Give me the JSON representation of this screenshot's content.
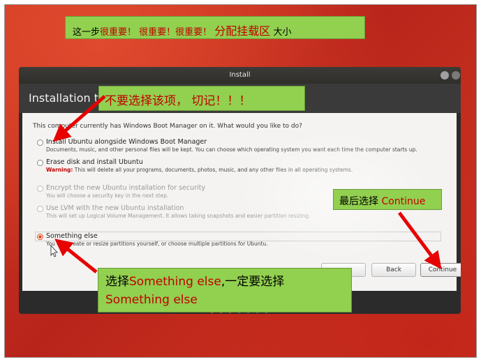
{
  "annotations": {
    "top_prefix": "这一步",
    "top_red": "很重要！ 很重要！很重要！",
    "top_partition": "分配挂载区",
    "top_suffix": "大小",
    "warning": "不要选择该项， 切记！！！",
    "last_prefix": "最后选择",
    "last_red": "Continue",
    "choose_prefix": "选择",
    "choose_red1": "Something else",
    "choose_middle": ",一定要选择",
    "choose_red2": "Something else"
  },
  "window": {
    "title": "Install",
    "header": "Installation type",
    "question": "This computer currently has Windows Boot Manager on it. What would you like to do?",
    "options": [
      {
        "title": "Install Ubuntu alongside Windows Boot Manager",
        "desc": "Documents, music, and other personal files will be kept. You can choose which operating system you want each time the computer starts up."
      },
      {
        "title": "Erase disk and install Ubuntu",
        "warning_label": "Warning:",
        "desc": " This will delete all your programs, documents, photos, music, and any other files in all operating systems."
      },
      {
        "title": "Encrypt the new Ubuntu installation for security",
        "desc": "You will choose a security key in the next step."
      },
      {
        "title": "Use LVM with the new Ubuntu installation",
        "desc": "This will set up Logical Volume Management. It allows taking snapshots and easier partition resizing."
      },
      {
        "title": "Something else",
        "desc": "You can create or resize partitions yourself, or choose multiple partitions for Ubuntu."
      }
    ],
    "buttons": {
      "back": "Back",
      "continue": "Continue"
    }
  }
}
